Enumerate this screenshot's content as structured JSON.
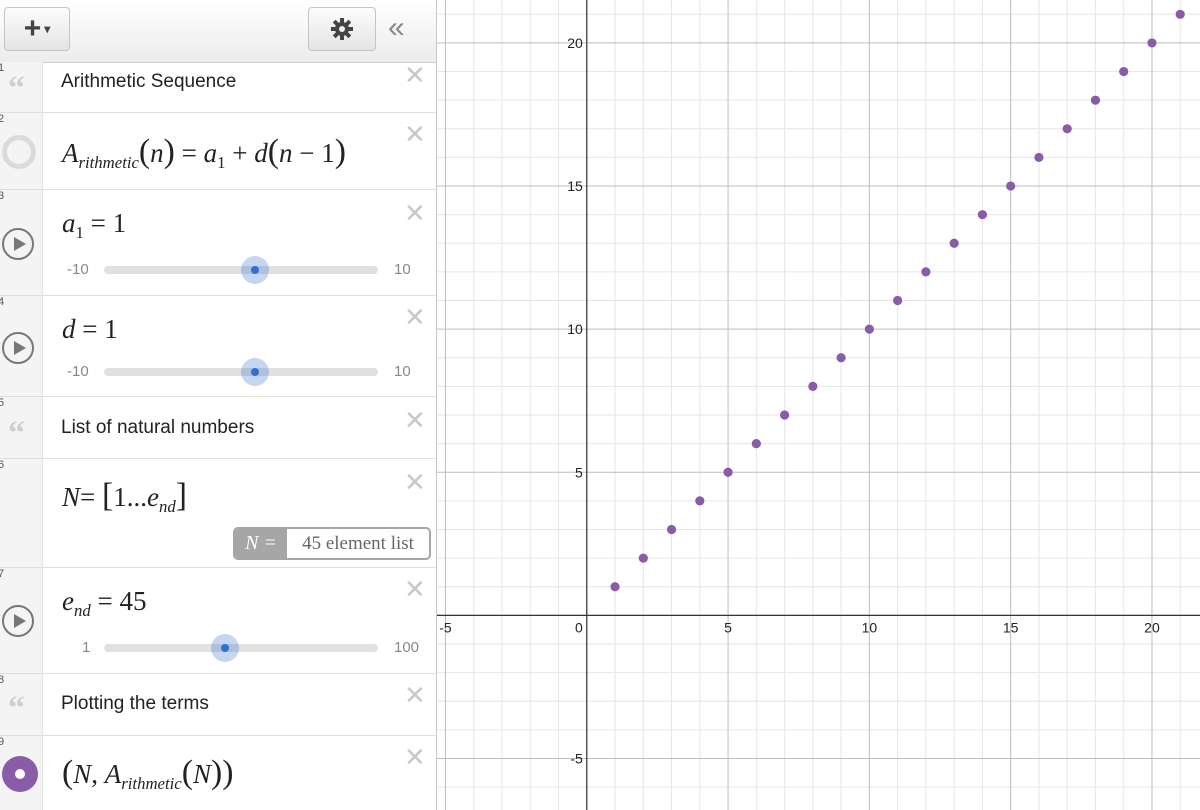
{
  "toolbar": {
    "add_icon": "plus-icon",
    "settings_icon": "gear-icon",
    "collapse_label": "«"
  },
  "expressions": {
    "row1": {
      "num": "1",
      "note": "Arithmetic Sequence"
    },
    "row2": {
      "num": "2",
      "fn": "A",
      "fn_sub": "rithmetic",
      "arg": "n",
      "a": "a",
      "a_sub": "1",
      "d": "d",
      "n": "n",
      "one": "1"
    },
    "row3": {
      "num": "3",
      "var": "a",
      "var_sub": "1",
      "value": "1",
      "min": "-10",
      "max": "10",
      "slider_fraction": 0.55
    },
    "row4": {
      "num": "4",
      "var": "d",
      "value": "1",
      "min": "-10",
      "max": "10",
      "slider_fraction": 0.55
    },
    "row5": {
      "num": "5",
      "note": "List of natural numbers"
    },
    "row6": {
      "num": "6",
      "var": "N",
      "start": "1",
      "ellipsis": "...",
      "end_var": "e",
      "end_sub": "nd",
      "badge_label": "N =",
      "badge_value": "45 element list"
    },
    "row7": {
      "num": "7",
      "var": "e",
      "var_sub": "nd",
      "value": "45",
      "min": "1",
      "max": "100",
      "slider_fraction": 0.44
    },
    "row8": {
      "num": "8",
      "note": "Plotting the terms"
    },
    "row9": {
      "num": "9",
      "x": "N",
      "fn": "A",
      "fn_sub": "rithmetic",
      "arg": "N",
      "point_color": "#8a5ba6"
    }
  },
  "graph": {
    "x_range": [
      -5.3,
      21.7
    ],
    "y_range": [
      -6.8,
      21.5
    ],
    "x_ticks": [
      "-5",
      "0",
      "5",
      "10",
      "15",
      "20"
    ],
    "y_ticks": [
      "20",
      "15",
      "10",
      "5",
      "-5"
    ],
    "origin_label": "0",
    "point_color": "#8a5ba6"
  },
  "chart_data": {
    "type": "scatter",
    "series": [
      {
        "x": [
          1,
          2,
          3,
          4,
          5,
          6,
          7,
          8,
          9,
          10,
          11,
          12,
          13,
          14,
          15,
          16,
          17,
          18,
          19,
          20,
          21
        ],
        "y": [
          1,
          2,
          3,
          4,
          5,
          6,
          7,
          8,
          9,
          10,
          11,
          12,
          13,
          14,
          15,
          16,
          17,
          18,
          19,
          20,
          21
        ]
      }
    ],
    "xlim": [
      -5.3,
      21.7
    ],
    "ylim": [
      -6.8,
      21.5
    ],
    "grid": true
  }
}
